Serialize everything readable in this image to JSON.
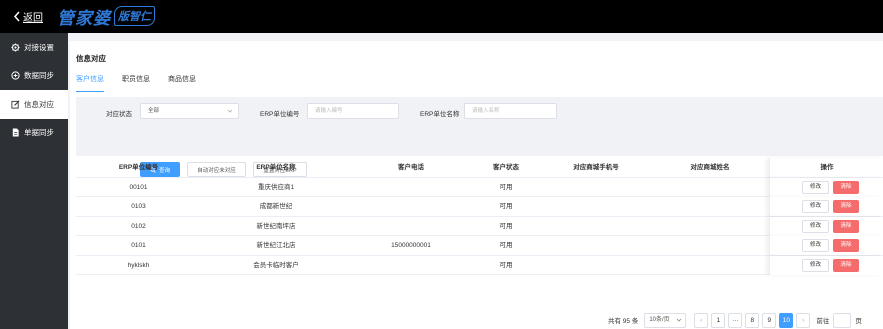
{
  "topbar": {
    "back_label": "返回",
    "logo_main": "管家婆",
    "logo_sub": "版智仁"
  },
  "sidebar": {
    "items": [
      {
        "label": "对接设置",
        "icon": "gear-icon"
      },
      {
        "label": "数据同步",
        "icon": "sync-icon"
      },
      {
        "label": "信息对应",
        "icon": "edit-icon"
      },
      {
        "label": "单据同步",
        "icon": "document-icon"
      }
    ],
    "active_index": 2
  },
  "page": {
    "title": "信息对应",
    "tabs": [
      "客户信息",
      "职员信息",
      "商品信息"
    ],
    "active_tab": 0
  },
  "filter": {
    "status_label": "对应状态",
    "status_value": "全部",
    "code_label": "ERP单位编号",
    "code_placeholder": "请输入编号",
    "name_label": "ERP单位名称",
    "name_placeholder": "请输入名称",
    "query_button": "查询",
    "auto_match_button": "自动对应未对应",
    "reset_button": "重置对应ERP"
  },
  "table": {
    "columns": [
      "ERP单位编号",
      "ERP单位名称",
      "客户电话",
      "客户状态",
      "对应商城手机号",
      "对应商城姓名",
      "操作"
    ],
    "rows": [
      {
        "code": "00101",
        "name": "重庆供应商1",
        "phone": "",
        "status": "可用",
        "mall_phone": "",
        "mall_name": ""
      },
      {
        "code": "0103",
        "name": "成都新世纪",
        "phone": "",
        "status": "可用",
        "mall_phone": "",
        "mall_name": ""
      },
      {
        "code": "0102",
        "name": "新世纪南坪店",
        "phone": "",
        "status": "可用",
        "mall_phone": "",
        "mall_name": ""
      },
      {
        "code": "0101",
        "name": "新世纪江北店",
        "phone": "15000000001",
        "status": "可用",
        "mall_phone": "",
        "mall_name": ""
      },
      {
        "code": "hyklskh",
        "name": "会员卡临时客户",
        "phone": "",
        "status": "可用",
        "mall_phone": "",
        "mall_name": ""
      }
    ],
    "edit_label": "修改",
    "delete_label": "清除"
  },
  "pagination": {
    "total_text": "共有 95 条",
    "page_size": "10条/页",
    "pages": [
      "1",
      "···",
      "8",
      "9",
      "10"
    ],
    "current_page": "10",
    "goto_label": "前往",
    "page_unit": "页"
  },
  "colors": {
    "primary": "#409eff",
    "danger": "#f56c6c",
    "sidebar_bg": "#2d3035",
    "topbar_bg": "#000000"
  }
}
